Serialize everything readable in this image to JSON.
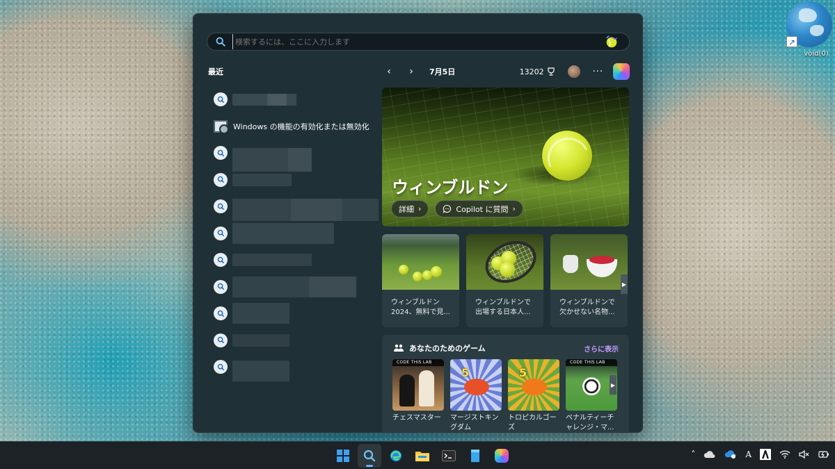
{
  "desktop": {
    "icon_label": "void(0)"
  },
  "search": {
    "placeholder": "検索するには、ここに入力します"
  },
  "recent": {
    "title": "最近",
    "items": [
      {
        "type": "search",
        "text": ""
      },
      {
        "type": "setting",
        "text": "Windows の機能の有効化または無効化"
      },
      {
        "type": "search",
        "text": ""
      },
      {
        "type": "search",
        "text": ""
      },
      {
        "type": "search",
        "text": ""
      },
      {
        "type": "search",
        "text": ""
      },
      {
        "type": "search",
        "text": ""
      },
      {
        "type": "search",
        "text": ""
      },
      {
        "type": "search",
        "text": ""
      },
      {
        "type": "search",
        "text": ""
      },
      {
        "type": "search",
        "text": ""
      }
    ]
  },
  "nav": {
    "date": "7月5日",
    "points": "13202"
  },
  "hero": {
    "title": "ウィンブルドン",
    "details_label": "詳細",
    "copilot_label": "Copilot に質問"
  },
  "news": [
    {
      "line1": "ウィンブルドン",
      "line2": "2024、無料で見..."
    },
    {
      "line1": "ウィンブルドンで",
      "line2": "出場する日本人..."
    },
    {
      "line1": "ウィンブルドンで",
      "line2": "欠かせない名物..."
    }
  ],
  "games": {
    "title": "あなたのためのゲーム",
    "more_label": "さらに表示",
    "badge_text": "CODE THIS LAB",
    "items": [
      {
        "line1": "チェスマスター",
        "line2": ""
      },
      {
        "line1": "マージストキン",
        "line2": "グダム"
      },
      {
        "line1": "トロピカルゴー",
        "line2": "ズ"
      },
      {
        "line1": "ペナルティーチ",
        "line2": "ャレンジ・マ..."
      }
    ]
  },
  "colors": {
    "panel_bg": "#1f3036",
    "card_bg": "#2a3c42",
    "accent_purple": "#c79cff",
    "taskbar_bg": "#1c2226"
  }
}
